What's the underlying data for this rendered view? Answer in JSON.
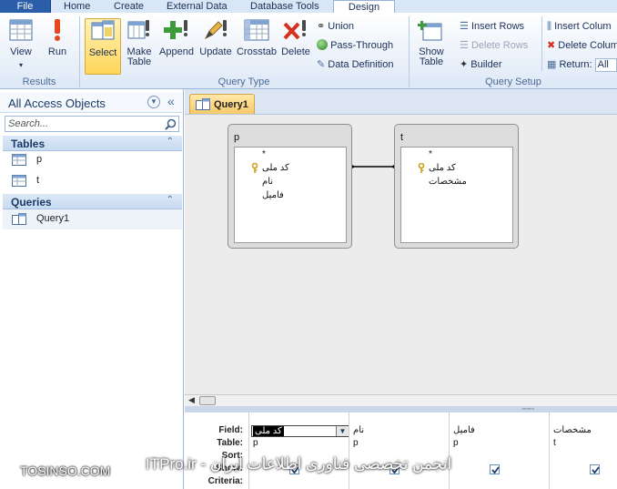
{
  "tabs": {
    "file": "File",
    "home": "Home",
    "create": "Create",
    "external": "External Data",
    "dbtools": "Database Tools",
    "design": "Design"
  },
  "ribbon": {
    "results": {
      "view": "View",
      "run": "Run",
      "label": "Results"
    },
    "query_type": {
      "select": "Select",
      "make_table_1": "Make",
      "make_table_2": "Table",
      "append": "Append",
      "update": "Update",
      "crosstab": "Crosstab",
      "delete": "Delete",
      "union": "Union",
      "pass_through": "Pass-Through",
      "data_definition": "Data Definition",
      "label": "Query Type"
    },
    "query_setup": {
      "show_table_1": "Show",
      "show_table_2": "Table",
      "insert_rows": "Insert Rows",
      "delete_rows": "Delete Rows",
      "builder": "Builder",
      "insert_columns": "Insert Colum",
      "delete_columns": "Delete Colum",
      "return_label": "Return:",
      "return_value": "All",
      "label": "Query Setup"
    }
  },
  "nav": {
    "title": "All Access Objects",
    "search_placeholder": "Search...",
    "groups": {
      "tables": "Tables",
      "queries": "Queries"
    },
    "tables": [
      "p",
      "t"
    ],
    "queries": [
      "Query1"
    ]
  },
  "document": {
    "tab_label": "Query1",
    "tables": [
      {
        "name": "p",
        "fields": [
          "*",
          "کد ملی",
          "نام",
          "فامیل"
        ],
        "key_field_index": 1
      },
      {
        "name": "t",
        "fields": [
          "*",
          "کد ملی",
          "مشخصات"
        ],
        "key_field_index": 1
      }
    ],
    "grid": {
      "row_labels": [
        "Field:",
        "Table:",
        "Sort:",
        "Show:",
        "Criteria:"
      ],
      "columns": [
        {
          "field": "کد ملی",
          "table": "p",
          "show": true
        },
        {
          "field": "نام",
          "table": "p",
          "show": true
        },
        {
          "field": "فامیل",
          "table": "p",
          "show": true
        },
        {
          "field": "مشخصات",
          "table": "t",
          "show": true
        }
      ]
    }
  },
  "watermark": {
    "left": "TOSINSO.COM",
    "center": "ITPro.ir - انجمن تخصصی فناوری اطلاعات ایران"
  }
}
